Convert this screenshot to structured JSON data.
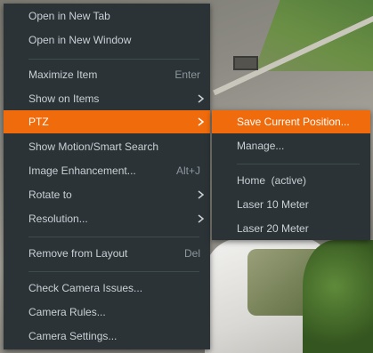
{
  "context_menu": {
    "items": [
      {
        "label": "Open in New Tab"
      },
      {
        "label": "Open in New Window"
      },
      {
        "label": "Maximize Item",
        "shortcut": "Enter"
      },
      {
        "label": "Show on Items"
      },
      {
        "label": "PTZ"
      },
      {
        "label": "Show Motion/Smart Search"
      },
      {
        "label": "Image Enhancement...",
        "shortcut": "Alt+J"
      },
      {
        "label": "Rotate to"
      },
      {
        "label": "Resolution..."
      },
      {
        "label": "Remove from Layout",
        "shortcut": "Del"
      },
      {
        "label": "Check Camera Issues..."
      },
      {
        "label": "Camera Rules..."
      },
      {
        "label": "Camera Settings..."
      }
    ]
  },
  "ptz_submenu": {
    "items": [
      {
        "label": "Save Current Position..."
      },
      {
        "label": "Manage..."
      },
      {
        "label": "Home  (active)"
      },
      {
        "label": "Laser 10 Meter"
      },
      {
        "label": "Laser 20 Meter"
      }
    ]
  },
  "colors": {
    "menu_background": "#2b3337",
    "highlight": "#f06b0b",
    "text": "#c9d1d6",
    "shortcut_text": "#8c979d"
  },
  "icons": {
    "submenu_arrow": "chevron-right-icon"
  }
}
